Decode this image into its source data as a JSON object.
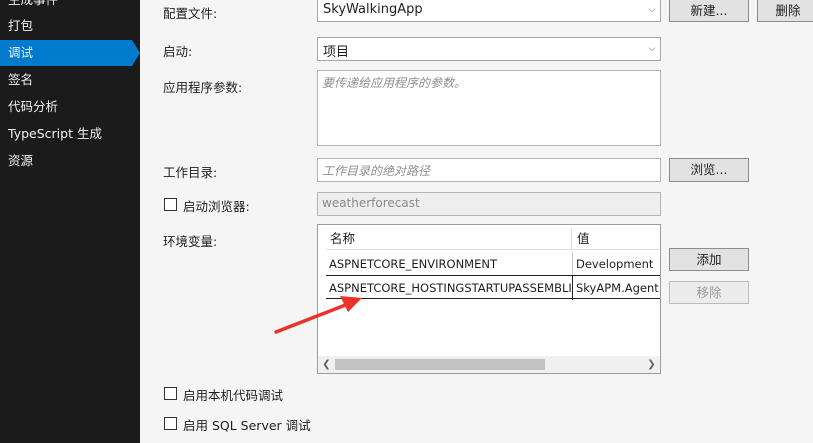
{
  "sidebar": {
    "items": [
      {
        "label": "生成事件"
      },
      {
        "label": "打包"
      },
      {
        "label": "调试"
      },
      {
        "label": "签名"
      },
      {
        "label": "代码分析"
      },
      {
        "label": "TypeScript 生成"
      },
      {
        "label": "资源"
      }
    ],
    "active_index": 2
  },
  "config": {
    "profile_label": "配置文件:",
    "profile_value": "SkyWalkingApp",
    "new_button": "新建...",
    "delete_button": "删除",
    "launch_label": "启动:",
    "launch_value": "项目",
    "args_label": "应用程序参数:",
    "args_placeholder": "要传递给应用程序的参数。",
    "workdir_label": "工作目录:",
    "workdir_placeholder": "工作目录的绝对路径",
    "browse_button": "浏览...",
    "launch_browser_label": "启动浏览器:",
    "launch_browser_value": "weatherforecast",
    "env_label": "环境变量:",
    "add_button": "添加",
    "remove_button": "移除",
    "native_debug_label": "启用本机代码调试",
    "sql_debug_label": "启用 SQL Server 调试"
  },
  "env_grid": {
    "columns": [
      "名称",
      "值"
    ],
    "rows": [
      {
        "name": "ASPNETCORE_ENVIRONMENT",
        "value": "Development"
      },
      {
        "name": "ASPNETCORE_HOSTINGSTARTUPASSEMBLIES",
        "value": "SkyAPM.Agent.AspNetCore"
      }
    ]
  },
  "colors": {
    "sidebar_bg": "#1b1b1c",
    "active_accent": "#007acc",
    "annotation_arrow": "#e8322a"
  },
  "icons": {
    "dropdown": "chevron-down-icon",
    "scroll_left": "scroll-left-icon",
    "scroll_right": "scroll-right-icon"
  }
}
